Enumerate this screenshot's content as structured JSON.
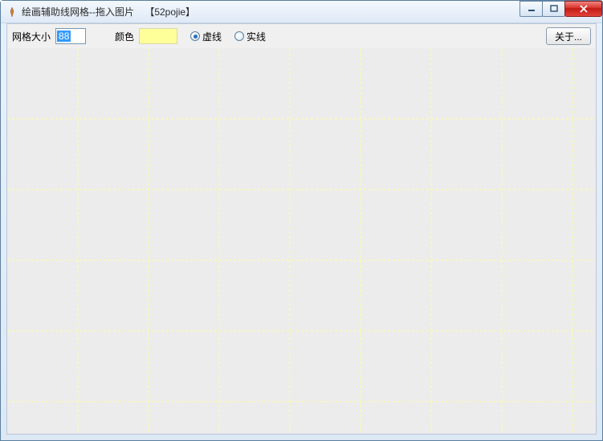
{
  "window": {
    "title": "绘画辅助线网格--拖入图片    【52pojie】"
  },
  "toolbar": {
    "grid_size_label": "网格大小",
    "grid_size_value": "88",
    "color_label": "颜色",
    "color_value": "#ffff99",
    "radio_dashed": "虚线",
    "radio_solid": "实线",
    "line_style_selected": "dashed",
    "about_label": "关于..."
  },
  "canvas": {
    "grid_spacing": 88,
    "line_color": "#ffff99"
  }
}
